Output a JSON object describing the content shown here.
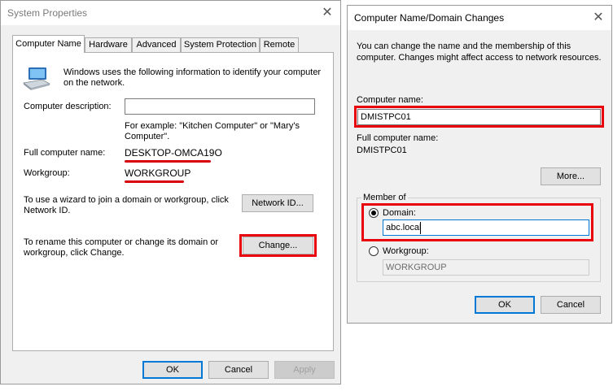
{
  "system_properties": {
    "title": "System Properties",
    "close_glyph": "✕",
    "tabs": [
      "Computer Name",
      "Hardware",
      "Advanced",
      "System Protection",
      "Remote"
    ],
    "intro_text_1": "Windows uses the following information to identify your computer",
    "intro_text_2": "on the network.",
    "description_label": "Computer description:",
    "description_value": "",
    "example_1": "For example: \"Kitchen Computer\" or \"Mary's",
    "example_2": "Computer\".",
    "full_name_label": "Full computer name:",
    "full_name_value": "DESKTOP-OMCA19O",
    "workgroup_label": "Workgroup:",
    "workgroup_value": "WORKGROUP",
    "wizard_text_1": "To use a wizard to join a domain or workgroup, click",
    "wizard_text_2": "Network ID.",
    "network_id_button": "Network ID...",
    "rename_text_1": "To rename this computer or change its domain or",
    "rename_text_2": "workgroup, click Change.",
    "change_button": "Change...",
    "ok_button": "OK",
    "cancel_button": "Cancel",
    "apply_button": "Apply"
  },
  "name_changes": {
    "title": "Computer Name/Domain Changes",
    "close_glyph": "✕",
    "intro_1": "You can change the name and the membership of this",
    "intro_2": "computer. Changes might affect access to network resources.",
    "computer_name_label": "Computer name:",
    "computer_name_value": "DMISTPC01",
    "full_name_label": "Full computer name:",
    "full_name_value": "DMISTPC01",
    "more_button": "More...",
    "member_of_label": "Member of",
    "domain_label": "Domain:",
    "domain_value": "abc.local",
    "domain_selected": true,
    "workgroup_label": "Workgroup:",
    "workgroup_value": "WORKGROUP",
    "ok_button": "OK",
    "cancel_button": "Cancel"
  },
  "colors": {
    "highlight_red": "#e8000d",
    "default_button_border": "#0078d7",
    "dialog_bg": "#f0f0f0"
  }
}
